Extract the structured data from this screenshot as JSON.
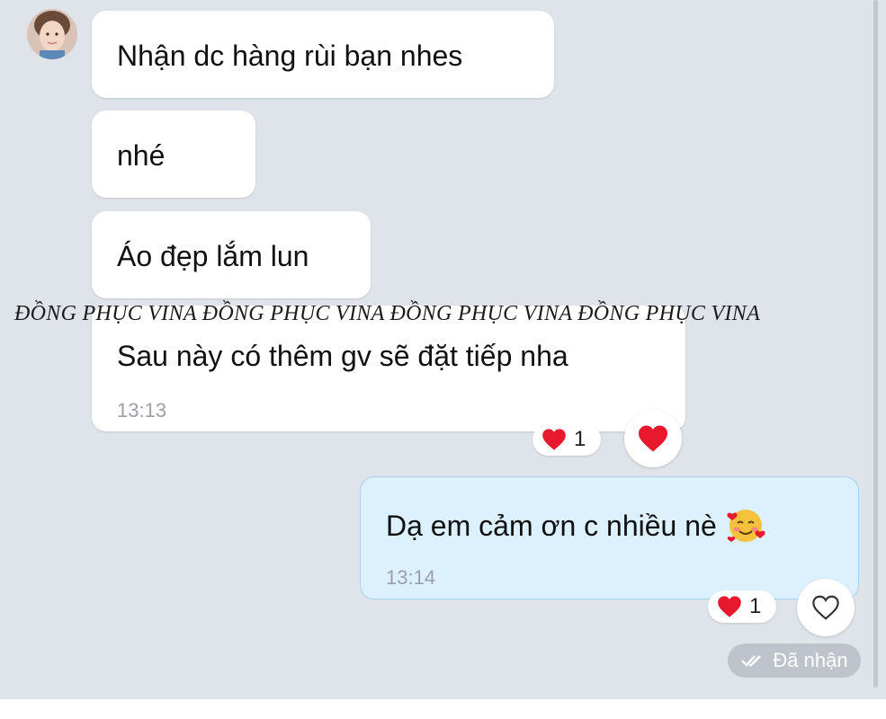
{
  "messages": [
    {
      "text": "Nhận dc hàng rùi bạn nhes"
    },
    {
      "text": "nhé"
    },
    {
      "text": "Áo đẹp lắm lun"
    },
    {
      "text": "Sau này có thêm gv sẽ đặt tiếp nha",
      "time": "13:13",
      "reaction_count": "1"
    },
    {
      "text": "Dạ em cảm ơn c nhiều nè",
      "emoji": "smiling-face-with-hearts",
      "time": "13:14",
      "reaction_count": "1"
    }
  ],
  "watermark": "ĐỒNG PHỤC VINA ĐỒNG PHỤC VINA ĐỒNG PHỤC VINA ĐỒNG PHỤC VINA",
  "status": "Đã nhận",
  "icons": {
    "reaction": "heart-icon",
    "react_button_filled": "heart-icon",
    "react_button_outline": "heart-outline-icon",
    "status": "double-check-icon"
  },
  "colors": {
    "background": "#dfe3ea",
    "incoming_bubble": "#ffffff",
    "outgoing_bubble": "#dcf0fd",
    "heart": "#e8192c",
    "status_pill": "#bfc4cc"
  }
}
